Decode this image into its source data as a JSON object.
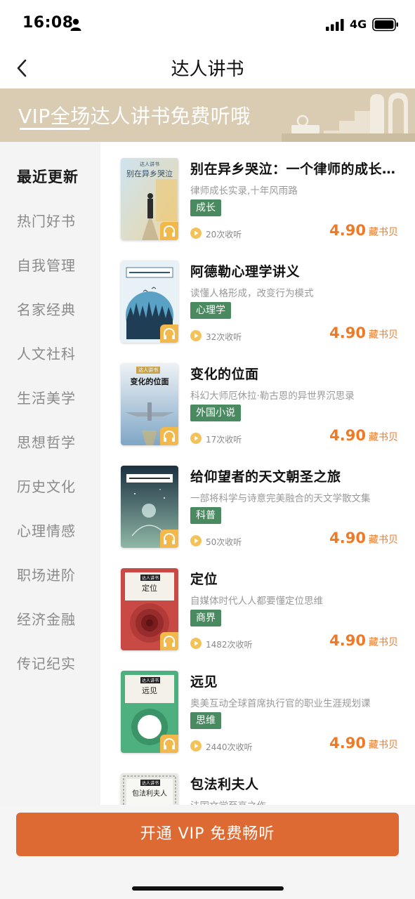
{
  "status_bar": {
    "time": "16:08",
    "network": "4G"
  },
  "nav": {
    "title": "达人讲书"
  },
  "banner": {
    "text": "VIP全场达人讲书免费听哦"
  },
  "sidebar": {
    "items": [
      {
        "label": "最近更新",
        "active": true
      },
      {
        "label": "热门好书"
      },
      {
        "label": "自我管理"
      },
      {
        "label": "名家经典"
      },
      {
        "label": "人文社科"
      },
      {
        "label": "生活美学"
      },
      {
        "label": "思想哲学"
      },
      {
        "label": "历史文化"
      },
      {
        "label": "心理情感"
      },
      {
        "label": "职场进阶"
      },
      {
        "label": "经济金融"
      },
      {
        "label": "传记纪实"
      }
    ]
  },
  "books": [
    {
      "title": "别在异乡哭泣：一个律师的成长实录",
      "desc": "律师成长实录,十年风雨路",
      "tag": "成长",
      "listens": "20次收听",
      "price": "4.90",
      "price_unit": "藏书贝",
      "cover": {
        "header": "达人讲书",
        "title": "别在异乡哭泣",
        "colors": [
          "#cfe3ef",
          "#e7d7a9"
        ]
      }
    },
    {
      "title": "阿德勒心理学讲义",
      "desc": "读懂人格形成，改变行为模式",
      "tag": "心理学",
      "listens": "32次收听",
      "price": "4.90",
      "price_unit": "藏书贝",
      "cover": {
        "header": "",
        "title": "",
        "colors": [
          "#d8ecf4",
          "#5aa1c6"
        ]
      }
    },
    {
      "title": "变化的位面",
      "desc": "科幻大师厄休拉·勒古恩的异世界沉思录",
      "tag": "外国小说",
      "listens": "17次收听",
      "price": "4.90",
      "price_unit": "藏书贝",
      "cover": {
        "header": "达人讲书",
        "title": "变化的位面",
        "colors": [
          "#e9eef3",
          "#3f6f9a"
        ]
      }
    },
    {
      "title": "给仰望者的天文朝圣之旅",
      "desc": "一部将科学与诗意完美融合的天文学散文集",
      "tag": "科普",
      "listens": "50次收听",
      "price": "4.90",
      "price_unit": "藏书贝",
      "cover": {
        "header": "",
        "title": "",
        "colors": [
          "#1b3040",
          "#8fb7a6"
        ]
      }
    },
    {
      "title": "定位",
      "desc": "自媒体时代人人都要懂定位思维",
      "tag": "商界",
      "listens": "1482次收听",
      "price": "4.90",
      "price_unit": "藏书贝",
      "cover": {
        "header": "达人讲书",
        "title": "定位",
        "colors": [
          "#c94a45",
          "#7a1b1d"
        ]
      }
    },
    {
      "title": "远见",
      "desc": "奥美互动全球首席执行官的职业生涯规划课",
      "tag": "思维",
      "listens": "2440次收听",
      "price": "4.90",
      "price_unit": "藏书贝",
      "cover": {
        "header": "达人讲书",
        "title": "远见",
        "colors": [
          "#4fb07f",
          "#2e7a57"
        ]
      }
    },
    {
      "title": "包法利夫人",
      "desc": "法国文学至高之作",
      "tag": "",
      "listens": "",
      "price": "",
      "price_unit": "",
      "cover": {
        "header": "达人讲书",
        "title": "包法利夫人",
        "colors": [
          "#e8e8e3",
          "#c9c9c0"
        ]
      }
    }
  ],
  "cta": {
    "label": "开通 VIP 免费畅听"
  },
  "colors": {
    "accent": "#4a8a60",
    "price": "#ee7a28",
    "cta": "#dd6a33",
    "banner": "#d9ccb3"
  }
}
